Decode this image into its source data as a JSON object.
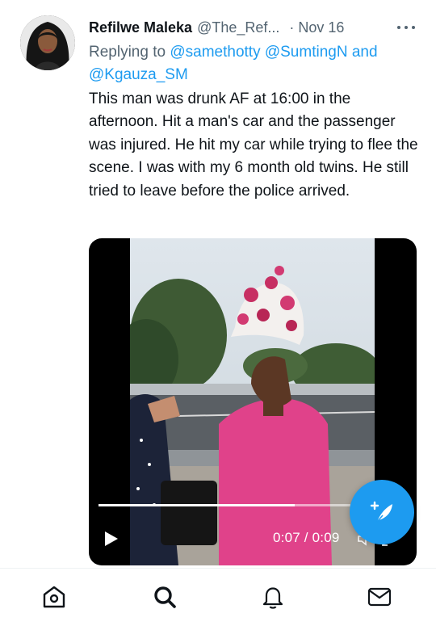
{
  "tweet": {
    "display_name": "Refilwe Maleka",
    "handle": "@The_Ref...",
    "separator": "·",
    "date": "Nov 16",
    "replying_prefix": "Replying to",
    "mentions": [
      "@samethotty",
      "@SumtingN"
    ],
    "conjunction": "and",
    "last_mention": "@Kgauza_SM",
    "text": "This man was drunk AF at 16:00 in the afternoon. Hit a man's car and the passenger was injured. He hit my car while trying to flee the scene. I was with my 6 month old twins. He still tried to leave before the police arrived."
  },
  "video": {
    "timecode": "0:07 / 0:09",
    "progress": 0.78
  },
  "icons": {
    "more": "more-horizontal-icon",
    "play": "play-icon",
    "volume": "volume-icon",
    "expand": "expand-icon",
    "compose": "compose-feather-icon",
    "home": "home-icon",
    "search": "search-icon",
    "notifications": "bell-icon",
    "messages": "mail-icon"
  },
  "colors": {
    "accent": "#1d9bf0",
    "secondary_text": "#536471",
    "primary_text": "#0f1419"
  }
}
